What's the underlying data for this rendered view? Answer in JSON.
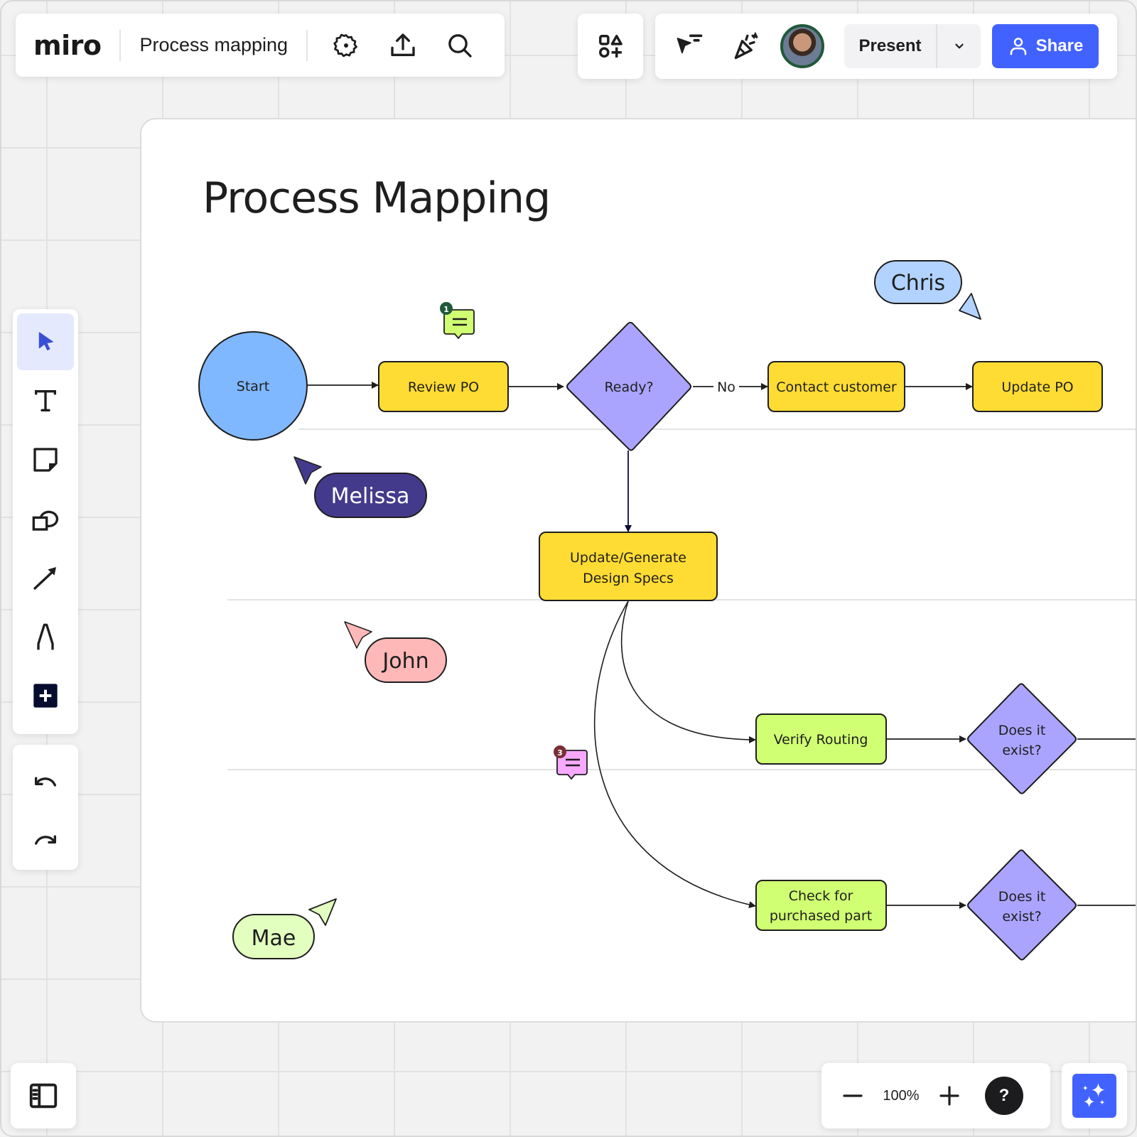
{
  "app": {
    "logo": "miro",
    "board_title": "Process mapping",
    "toolbar_icons": [
      "gear-icon",
      "upload-icon",
      "search-icon"
    ]
  },
  "collab": {
    "present_label": "Present",
    "share_label": "Share",
    "accent_color": "#4262ff"
  },
  "frame": {
    "title": "Process Mapping"
  },
  "flow": {
    "nodes": {
      "start": "Start",
      "review_po": "Review PO",
      "ready": "Ready?",
      "contact_customer": "Contact customer",
      "update_po": "Update PO",
      "update_generate_1": "Update/Generate",
      "update_generate_2": "Design Specs",
      "verify_routing": "Verify Routing",
      "does_exist_1a": "Does it",
      "does_exist_1b": "exist?",
      "check_purchased_1": "Check for",
      "check_purchased_2": "purchased part",
      "does_exist_2a": "Does it",
      "does_exist_2b": "exist?"
    },
    "edge_labels": {
      "no": "No"
    },
    "colors": {
      "start": "#80b8ff",
      "process": "#ffdc33",
      "decision": "#aba4ff",
      "green_process": "#d0ff73"
    }
  },
  "comments": [
    {
      "count": "1",
      "color": "#d0ff73",
      "badge": "#1f5a3a"
    },
    {
      "count": "3",
      "color": "#f7a8ff",
      "badge": "#7a2e34"
    }
  ],
  "cursors": [
    {
      "name": "Chris",
      "color": "#b2d2ff",
      "text_color": "#1e1e1e"
    },
    {
      "name": "Melissa",
      "color": "#443a8c",
      "text_color": "#ffffff"
    },
    {
      "name": "John",
      "color": "#ffb8b8",
      "text_color": "#1e1e1e"
    },
    {
      "name": "Mae",
      "color": "#e2ffbf",
      "text_color": "#1e1e1e"
    }
  ],
  "tools": [
    "select",
    "text",
    "sticky-note",
    "shapes",
    "connector",
    "pen",
    "more"
  ],
  "zoom": {
    "value": "100%",
    "help": "?"
  }
}
